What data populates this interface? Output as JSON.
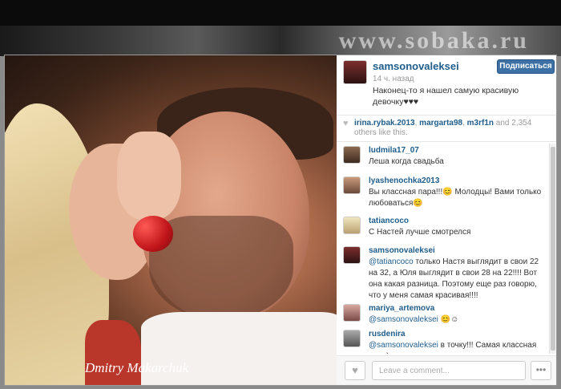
{
  "banner": {
    "text": "www.sobaka.ru"
  },
  "photo": {
    "signature": "Dmitry Makarchuk"
  },
  "post": {
    "username": "samsonovaleksei",
    "follow_label": "Подписаться",
    "time": "14 ч. назад",
    "caption": "Наконец-то я нашел самую красивую девочку♥♥♥"
  },
  "likes": {
    "users": [
      "irina.rybak.2013",
      "margarta98",
      "m3rf1n"
    ],
    "sep1": ", ",
    "sep2": ", ",
    "rest": " and 2,354 others like this."
  },
  "comments": [
    {
      "user": "ludmila17_07",
      "text": "Леша когда свадьба"
    },
    {
      "user": "lyashenochka2013",
      "text": "Вы классная пара!!!😊 Молодцы! Вами только любоваться😊"
    },
    {
      "user": "tatiancoco",
      "text": "С Настей лучше смотрелся"
    },
    {
      "user": "samsonovaleksei",
      "mention": "@tatiancoco",
      "text": " только Настя выглядит в свои 22 на 32, а Юля выглядит в свои 28 на 22!!!! Вот она какая разница. Поэтому еще раз говорю, что у меня самая красивая!!!!"
    },
    {
      "user": "mariya_artemova",
      "mention": "@samsonovaleksei",
      "text": " 😊☺"
    },
    {
      "user": "rusdenira",
      "mention": "@samsonovaleksei",
      "text": " в точку!!! Самая классная пара)"
    }
  ],
  "footer": {
    "placeholder": "Leave a comment...",
    "more_label": "•••"
  },
  "icons": {
    "like": "heart-icon",
    "more": "more-dots-icon"
  }
}
